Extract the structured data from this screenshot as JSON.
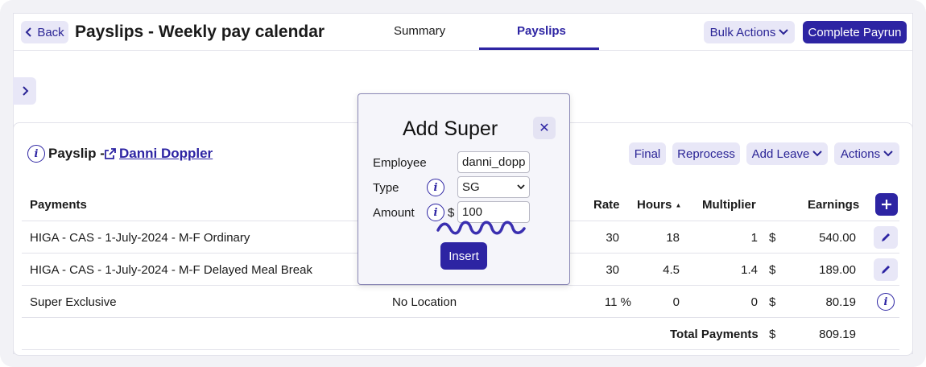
{
  "header": {
    "back_label": "Back",
    "title": "Payslips - Weekly pay calendar",
    "tabs": [
      {
        "label": "Summary",
        "active": false
      },
      {
        "label": "Payslips",
        "active": true
      }
    ],
    "bulk_actions_label": "Bulk Actions",
    "complete_payrun_label": "Complete Payrun"
  },
  "payslip": {
    "label": "Payslip -",
    "employee_name": "Danni Doppler",
    "buttons": {
      "final": "Final",
      "reprocess": "Reprocess",
      "add_leave": "Add Leave",
      "actions": "Actions"
    }
  },
  "table": {
    "headers": {
      "payments": "Payments",
      "rate": "Rate",
      "hours": "Hours",
      "hours_sort": "▲",
      "multiplier": "Multiplier",
      "earnings": "Earnings"
    },
    "rows": [
      {
        "name": "HIGA - CAS - 1-July-2024 - M-F Ordinary",
        "location": "",
        "rate": "30",
        "hours": "18",
        "multiplier": "1",
        "currency": "$",
        "earnings": "540.00",
        "action": "edit"
      },
      {
        "name": "HIGA - CAS - 1-July-2024 - M-F Delayed Meal Break",
        "location": "",
        "rate": "30",
        "hours": "4.5",
        "multiplier": "1.4",
        "currency": "$",
        "earnings": "189.00",
        "action": "edit"
      },
      {
        "name": "Super Exclusive",
        "location": "No Location",
        "rate": "11 %",
        "hours": "0",
        "multiplier": "0",
        "currency": "$",
        "earnings": "80.19",
        "action": "info"
      }
    ],
    "total": {
      "label": "Total Payments",
      "currency": "$",
      "value": "809.19"
    }
  },
  "modal": {
    "title": "Add Super",
    "close_symbol": "✕",
    "employee_label": "Employee",
    "employee_value": "danni_doppl",
    "type_label": "Type",
    "type_value": "SG",
    "amount_label": "Amount",
    "amount_currency": "$",
    "amount_value": "100",
    "insert_label": "Insert"
  },
  "colors": {
    "accent": "#2d24a3",
    "accent_light": "#e8e7f7",
    "annotation_scribble": "#3a2fb0"
  }
}
